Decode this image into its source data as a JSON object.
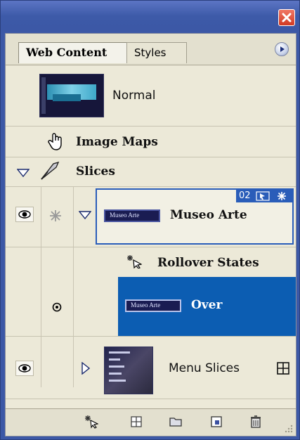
{
  "panel": {
    "tabs": [
      {
        "label": "Web Content",
        "active": true
      },
      {
        "label": "Styles",
        "active": false
      }
    ]
  },
  "rows": {
    "normal": {
      "label": "Normal"
    },
    "image_maps": {
      "label": "Image Maps"
    },
    "slices": {
      "label": "Slices"
    },
    "museo": {
      "label": "Museo Arte",
      "badge_number": "02",
      "thumb_text": "Museo Arte"
    },
    "rollover": {
      "label": "Rollover States"
    },
    "over": {
      "label": "Over",
      "thumb_text": "Museo Arte"
    },
    "menu_slices": {
      "label": "Menu Slices"
    }
  },
  "colors": {
    "selected_row": "#0c5db2",
    "title_blue": "#3d5aa8",
    "panel_bg": "#ece9d8"
  }
}
